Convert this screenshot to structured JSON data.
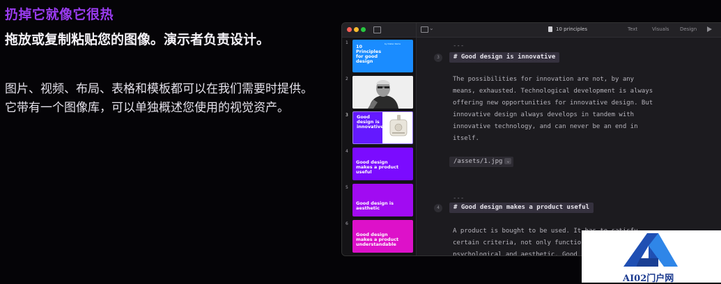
{
  "hero": {
    "title": "扔掉它就像它很热",
    "subtitle": "拖放或复制粘贴您的图像。演示者负责设计。",
    "description": "图片、视频、布局、表格和模板都可以在我们需要时提供。它带有一个图像库，可以单独概述您使用的视觉资产。"
  },
  "window": {
    "document_title": "10 principles",
    "tabs": [
      "Text",
      "Visuals",
      "Design"
    ],
    "colors": {
      "accent": "#6419ff",
      "slide_blue": "#1a8cff",
      "slide_violet": "#7b0bff",
      "slide_purple": "#a10bf2",
      "slide_magenta": "#dd11c9"
    }
  },
  "slides": [
    {
      "number": "1",
      "text": "10 Principles for good design",
      "small": "by Dieter Rams"
    },
    {
      "number": "2",
      "text": ""
    },
    {
      "number": "3",
      "text": "Good design is innovative"
    },
    {
      "number": "4",
      "text": "Good design makes a product useful"
    },
    {
      "number": "5",
      "text": "Good design is aesthetic"
    },
    {
      "number": "6",
      "text": "Good design makes a product understandable"
    }
  ],
  "editor": {
    "separator": "---",
    "block3": {
      "number": "3",
      "heading": "# Good design is innovative",
      "lines": [
        "The possibilities for innovation are not, by any",
        "means, exhausted. Technological development is always",
        "offering new opportunities for innovative design. But",
        "innovative design always develops in tandem with",
        "innovative technology, and can never be an end in",
        "itself."
      ],
      "asset": "/assets/1.jpg"
    },
    "block4": {
      "number": "4",
      "heading": "# Good design makes a product useful",
      "lines": [
        "A product is bought to be used. It has to satisfy",
        "certain criteria, not only functional, but also",
        "psychological and aesthetic. Good"
      ]
    }
  },
  "watermark": {
    "text": "AI02门户网"
  }
}
